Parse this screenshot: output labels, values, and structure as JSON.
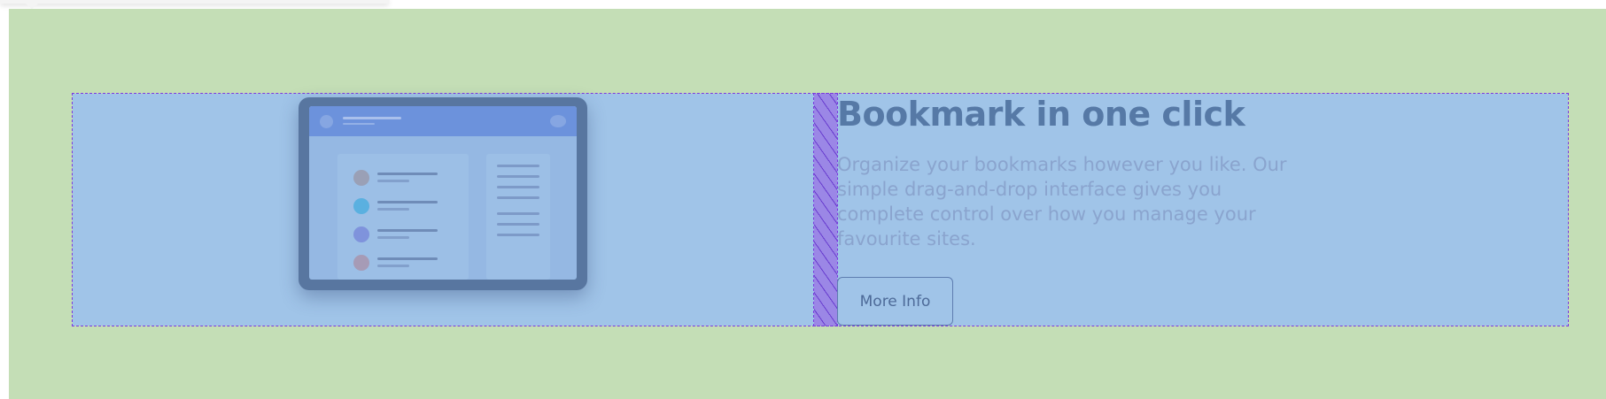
{
  "feature": {
    "heading": "Bookmark in one click",
    "description": "Organize your bookmarks however you like. Our simple drag-and-drop interface gives you complete control over how you manage your favourite sites.",
    "button_label": "More Info"
  },
  "colors": {
    "section_background": "#c4deb6",
    "flex_overlay": "#a0c4e8",
    "gap_hatch": "#9b87e6",
    "overlay_border": "#7b36e0",
    "heading_text": "#5679a6",
    "body_text": "#8aa4ce",
    "illustration_dot_1": "#9aa0b6",
    "illustration_dot_2": "#5ab0e0",
    "illustration_dot_3": "#7f93dc",
    "illustration_dot_4": "#a69bb6"
  },
  "icons": {
    "illustration": "browser-bookmarks-illustration"
  }
}
